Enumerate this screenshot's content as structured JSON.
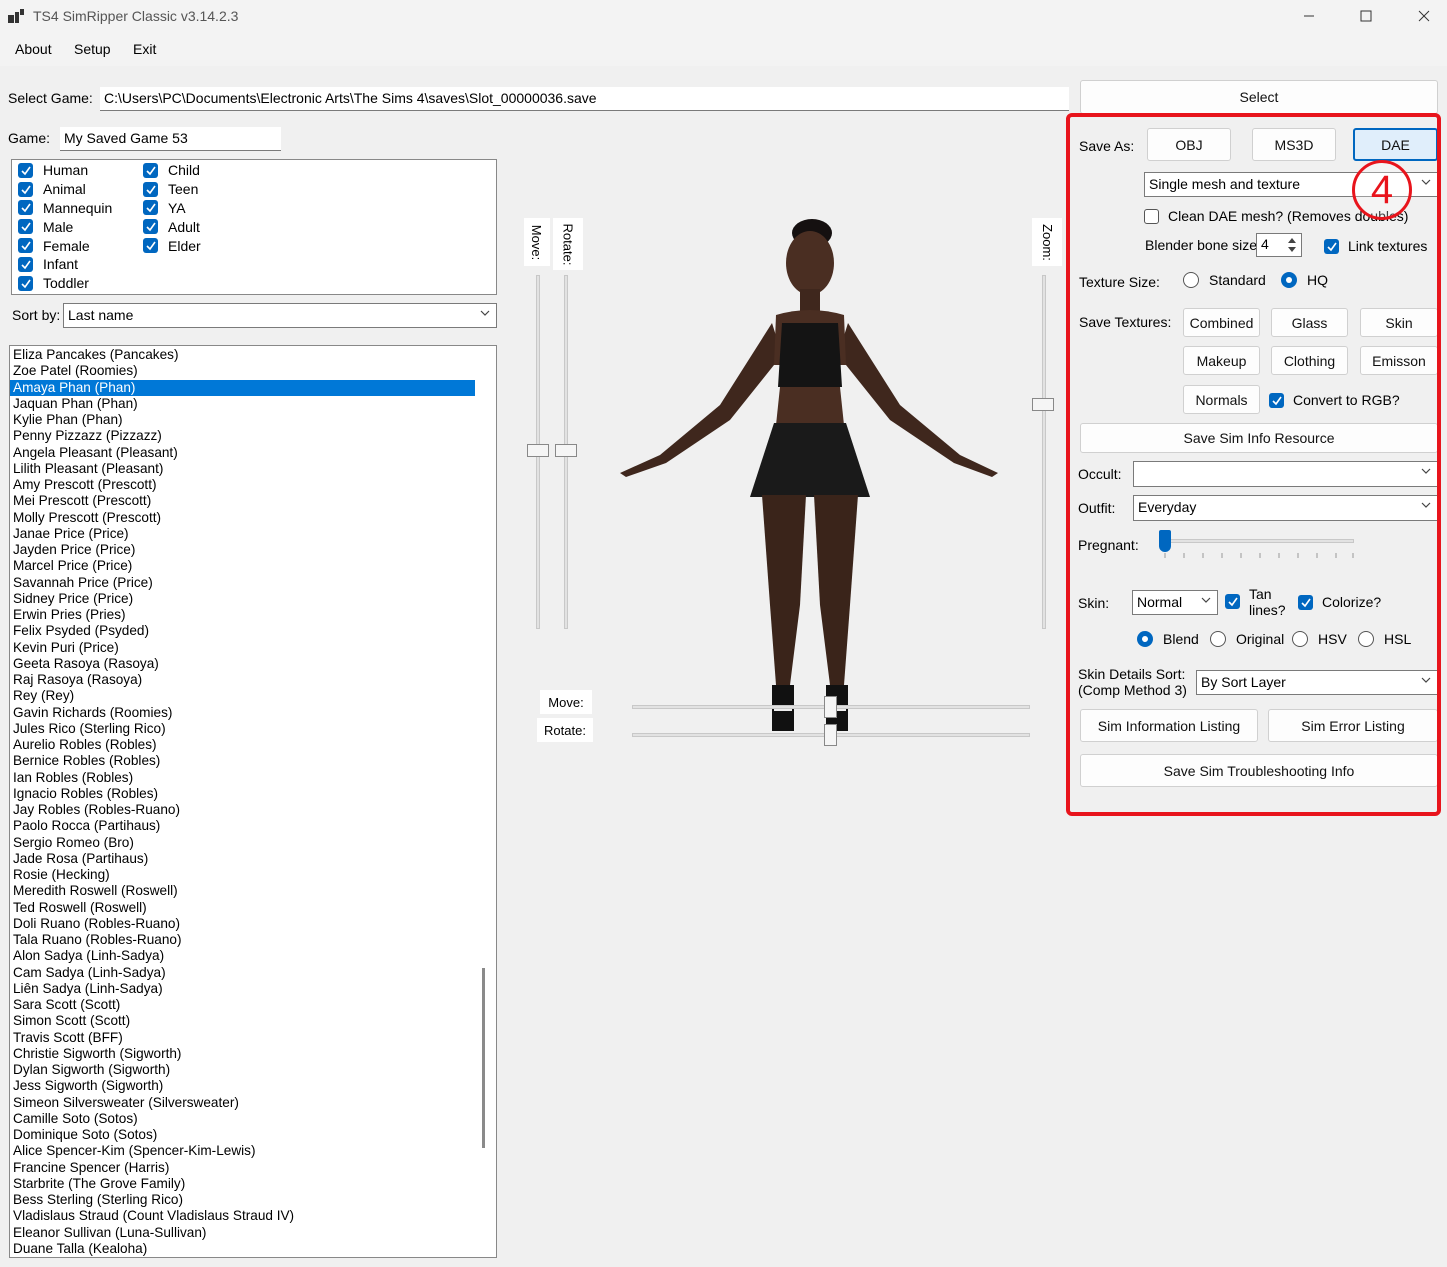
{
  "window": {
    "title": "TS4 SimRipper Classic v3.14.2.3",
    "minimize_icon": "minimize-icon",
    "maximize_icon": "maximize-icon",
    "close_icon": "close-icon"
  },
  "menu": [
    "About",
    "Setup",
    "Exit"
  ],
  "select_game": {
    "label": "Select Game:",
    "path": "C:\\Users\\PC\\Documents\\Electronic Arts\\The Sims 4\\saves\\Slot_00000036.save",
    "button": "Select"
  },
  "game": {
    "label": "Game:",
    "value": "My Saved Game 53"
  },
  "filters": {
    "col1": [
      {
        "label": "Human",
        "checked": true
      },
      {
        "label": "Animal",
        "checked": true
      },
      {
        "label": "Mannequin",
        "checked": true
      },
      {
        "label": "Male",
        "checked": true
      },
      {
        "label": "Female",
        "checked": true
      },
      {
        "label": "Infant",
        "checked": true
      },
      {
        "label": "Toddler",
        "checked": true
      }
    ],
    "col2": [
      {
        "label": "Child",
        "checked": true
      },
      {
        "label": "Teen",
        "checked": true
      },
      {
        "label": "YA",
        "checked": true
      },
      {
        "label": "Adult",
        "checked": true
      },
      {
        "label": "Elder",
        "checked": true
      }
    ]
  },
  "sort": {
    "label": "Sort by:",
    "value": "Last name"
  },
  "sims": [
    "Eliza Pancakes (Pancakes)",
    "Zoe Patel (Roomies)",
    "Amaya Phan (Phan)",
    "Jaquan Phan (Phan)",
    "Kylie Phan (Phan)",
    "Penny Pizzazz (Pizzazz)",
    "Angela Pleasant (Pleasant)",
    "Lilith Pleasant (Pleasant)",
    "Amy Prescott (Prescott)",
    "Mei Prescott (Prescott)",
    "Molly Prescott (Prescott)",
    "Janae Price (Price)",
    "Jayden Price (Price)",
    "Marcel Price (Price)",
    "Savannah Price (Price)",
    "Sidney Price (Price)",
    "Erwin Pries (Pries)",
    "Felix Psyded (Psyded)",
    "Kevin Puri (Price)",
    "Geeta Rasoya (Rasoya)",
    "Raj Rasoya (Rasoya)",
    "Rey  (Rey)",
    "Gavin Richards (Roomies)",
    "Jules Rico (Sterling Rico)",
    "Aurelio Robles (Robles)",
    "Bernice Robles (Robles)",
    "Ian Robles (Robles)",
    "Ignacio Robles (Robles)",
    "Jay Robles (Robles-Ruano)",
    "Paolo Rocca (Partihaus)",
    "Sergio Romeo (Bro)",
    "Jade Rosa (Partihaus)",
    "Rosie  (Hecking)",
    "Meredith Roswell (Roswell)",
    "Ted Roswell (Roswell)",
    "Doli Ruano (Robles-Ruano)",
    "Tala Ruano (Robles-Ruano)",
    "Alon Sadya (Linh-Sadya)",
    "Cam Sadya (Linh-Sadya)",
    "Liên Sadya (Linh-Sadya)",
    "Sara Scott (Scott)",
    "Simon Scott (Scott)",
    "Travis Scott (BFF)",
    "Christie Sigworth (Sigworth)",
    "Dylan Sigworth (Sigworth)",
    "Jess Sigworth (Sigworth)",
    "Simeon Silversweater (Silversweater)",
    "Camille Soto (Sotos)",
    "Dominique Soto (Sotos)",
    "Alice Spencer-Kim (Spencer-Kim-Lewis)",
    "Francine Spencer (Harris)",
    "Starbrite  (The Grove Family)",
    "Bess Sterling (Sterling Rico)",
    "Vladislaus Straud (Count Vladislaus Straud IV)",
    "Eleanor Sullivan (Luna-Sullivan)",
    "Duane Talla (Kealoha)"
  ],
  "selected_sim_index": 2,
  "viewer": {
    "move_label": "Move:",
    "rotate_label": "Rotate:",
    "zoom_label": "Zoom:",
    "h_move_label": "Move:",
    "h_rotate_label": "Rotate:"
  },
  "export": {
    "save_as_label": "Save As:",
    "formats": [
      "OBJ",
      "MS3D",
      "DAE"
    ],
    "selected_format": "DAE",
    "mesh_mode": "Single mesh and texture",
    "annotation": "4",
    "clean_dae": {
      "label": "Clean DAE mesh? (Removes doubles)",
      "checked": false
    },
    "bone_size_label": "Blender bone size",
    "bone_size": "4",
    "link_textures": {
      "label": "Link textures",
      "checked": true
    },
    "texture_size_label": "Texture Size:",
    "texture_sizes": [
      {
        "label": "Standard",
        "on": false
      },
      {
        "label": "HQ",
        "on": true
      }
    ],
    "save_textures_label": "Save Textures:",
    "texture_buttons": [
      "Combined",
      "Glass",
      "Skin",
      "Makeup",
      "Clothing",
      "Emisson",
      "Normals"
    ],
    "convert_rgb": {
      "label": "Convert to RGB?",
      "checked": true
    },
    "save_info_button": "Save Sim Info Resource",
    "occult_label": "Occult:",
    "occult_value": "",
    "outfit_label": "Outfit:",
    "outfit_value": "Everyday",
    "pregnant_label": "Pregnant:",
    "pregnant_level": 0,
    "skin_label": "Skin:",
    "skin_value": "Normal",
    "tan_lines": {
      "label": "Tan lines?",
      "checked": true
    },
    "colorize": {
      "label": "Colorize?",
      "checked": true
    },
    "blend_modes": [
      {
        "label": "Blend",
        "on": true
      },
      {
        "label": "Original",
        "on": false
      },
      {
        "label": "HSV",
        "on": false
      },
      {
        "label": "HSL",
        "on": false
      }
    ],
    "skin_details_label_1": "Skin Details Sort:",
    "skin_details_label_2": "(Comp Method 3)",
    "skin_details_value": "By Sort Layer",
    "info_listing_button": "Sim Information Listing",
    "error_listing_button": "Sim Error Listing",
    "troubleshooting_button": "Save Sim Troubleshooting Info"
  },
  "colors": {
    "accent": "#0067c0",
    "highlight": "#0078d7",
    "annotation": "#e8141c"
  }
}
